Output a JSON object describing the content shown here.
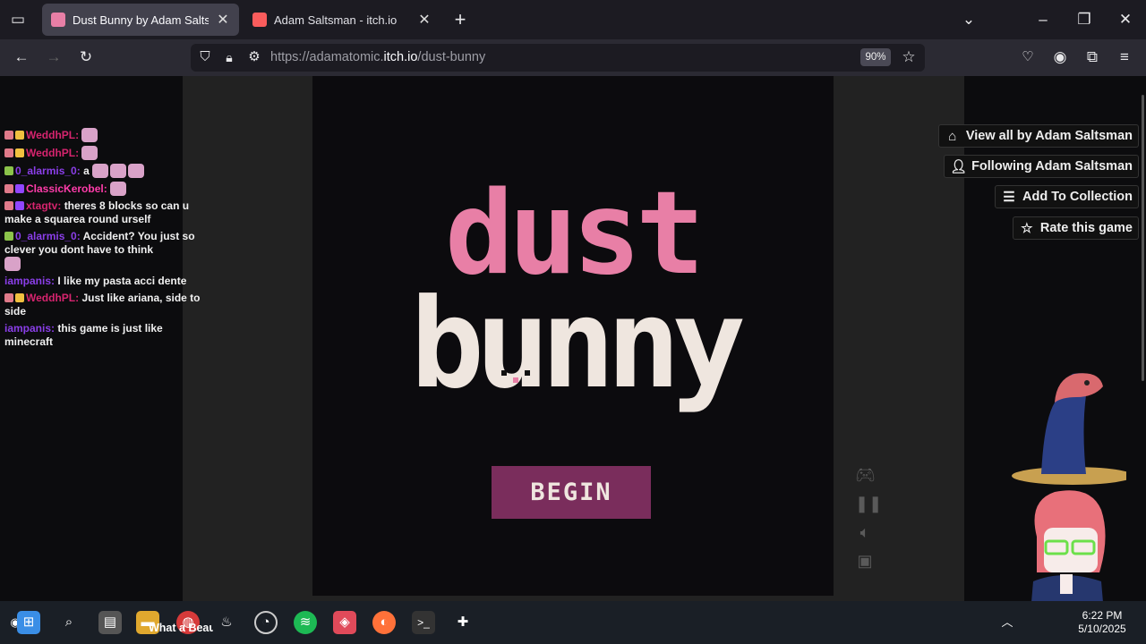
{
  "browser": {
    "tabs": [
      {
        "title": "Dust Bunny by Adam Saltsman",
        "active": true
      },
      {
        "title": "Adam Saltsman - itch.io",
        "active": false
      }
    ],
    "url_prefix": "https://adamatomic.",
    "url_domain": "itch.io",
    "url_path": "/dust-bunny",
    "zoom": "90%"
  },
  "game": {
    "title_line1": "dust",
    "title_line2": "bunny",
    "begin_label": "BEGIN",
    "colors": {
      "pink": "#e87fa6",
      "cream": "#efe6df",
      "button": "#7a2d5c"
    }
  },
  "itch_actions": [
    {
      "label": "View all by Adam Saltsman",
      "icon": "store-icon"
    },
    {
      "label": "Following Adam Saltsman",
      "icon": "user-check-icon"
    },
    {
      "label": "Add To Collection",
      "icon": "list-add-icon"
    },
    {
      "label": "Rate this game",
      "icon": "star-icon"
    }
  ],
  "chat": [
    {
      "user": "WeddhPL:",
      "text": ""
    },
    {
      "user": "WeddhPL:",
      "text": ""
    },
    {
      "user": "0_alarmis_0:",
      "text": "a"
    },
    {
      "user": "ClassicKerobel:",
      "text": ""
    },
    {
      "user": "xtagtv:",
      "text": "theres 8 blocks so can u make a squarea round urself"
    },
    {
      "user": "0_alarmis_0:",
      "text": "Accident? You just so clever you dont have to think"
    },
    {
      "user": "iampanis:",
      "text": "I like my pasta acci dente"
    },
    {
      "user": "WeddhPL:",
      "text": "Just like ariana, side to side"
    },
    {
      "user": "iampanis:",
      "text": "this game is just like minecraft"
    }
  ],
  "taskbar": {
    "active_window_label": "What a Beaut",
    "time": "6:22 PM",
    "date": "5/10/2025"
  }
}
